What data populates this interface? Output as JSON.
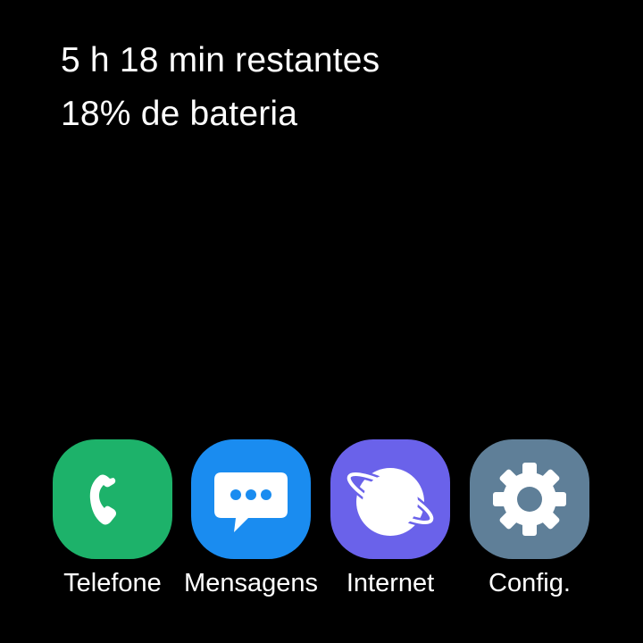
{
  "status": {
    "time_remaining": "5 h 18 min restantes",
    "battery_level": "18% de bateria"
  },
  "apps": [
    {
      "label": "Telefone",
      "icon": "phone-icon",
      "color": "#1db26a"
    },
    {
      "label": "Mensagens",
      "icon": "message-bubble-icon",
      "color": "#1a8cf0"
    },
    {
      "label": "Internet",
      "icon": "planet-icon",
      "color": "#6a62ea"
    },
    {
      "label": "Config.",
      "icon": "gear-icon",
      "color": "#5f7f98"
    }
  ],
  "colors": {
    "background": "#000000",
    "text": "#ffffff"
  }
}
